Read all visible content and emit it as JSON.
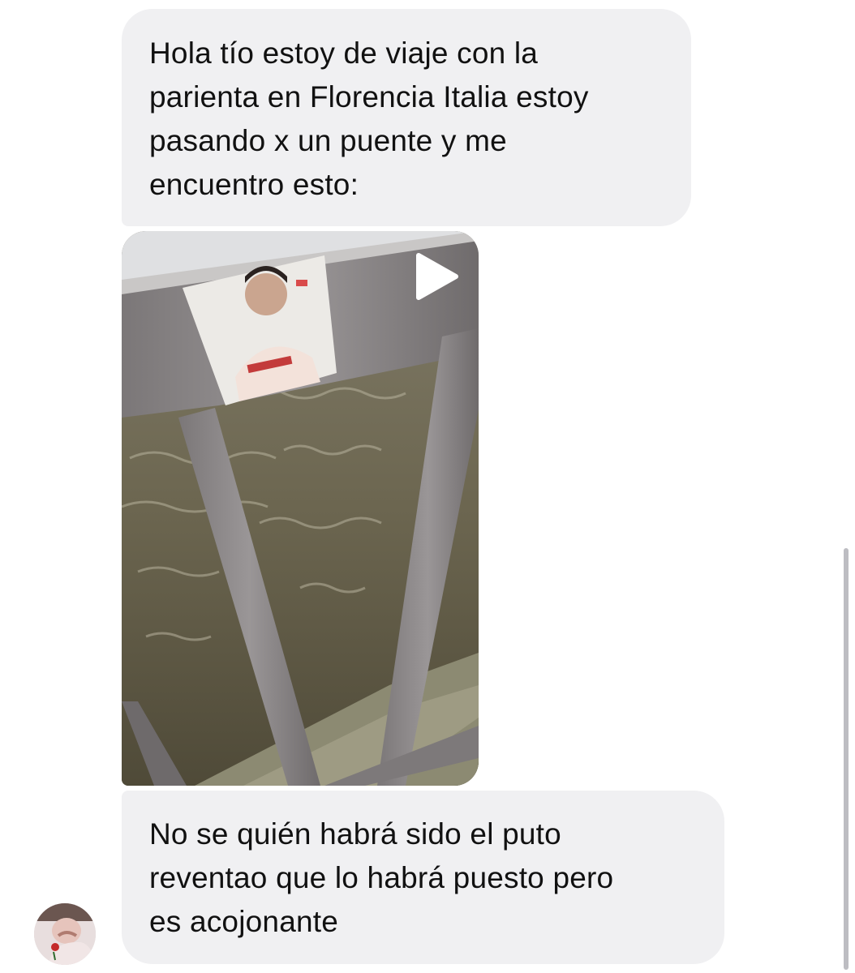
{
  "messages": [
    {
      "text": "Hola tío estoy de viaje con la\nparienta en Florencia Italia estoy\npasando x un puente y me\nencuentro esto:"
    },
    {
      "type": "video",
      "icon": "play-icon"
    },
    {
      "text": "No se quién habrá sido el puto\nreventao que lo habrá puesto pero\nes acojonante"
    }
  ],
  "sender": {
    "avatar_icon": "avatar"
  },
  "colors": {
    "bubble_background": "#f0f0f2",
    "text": "#111111",
    "background": "#ffffff"
  }
}
